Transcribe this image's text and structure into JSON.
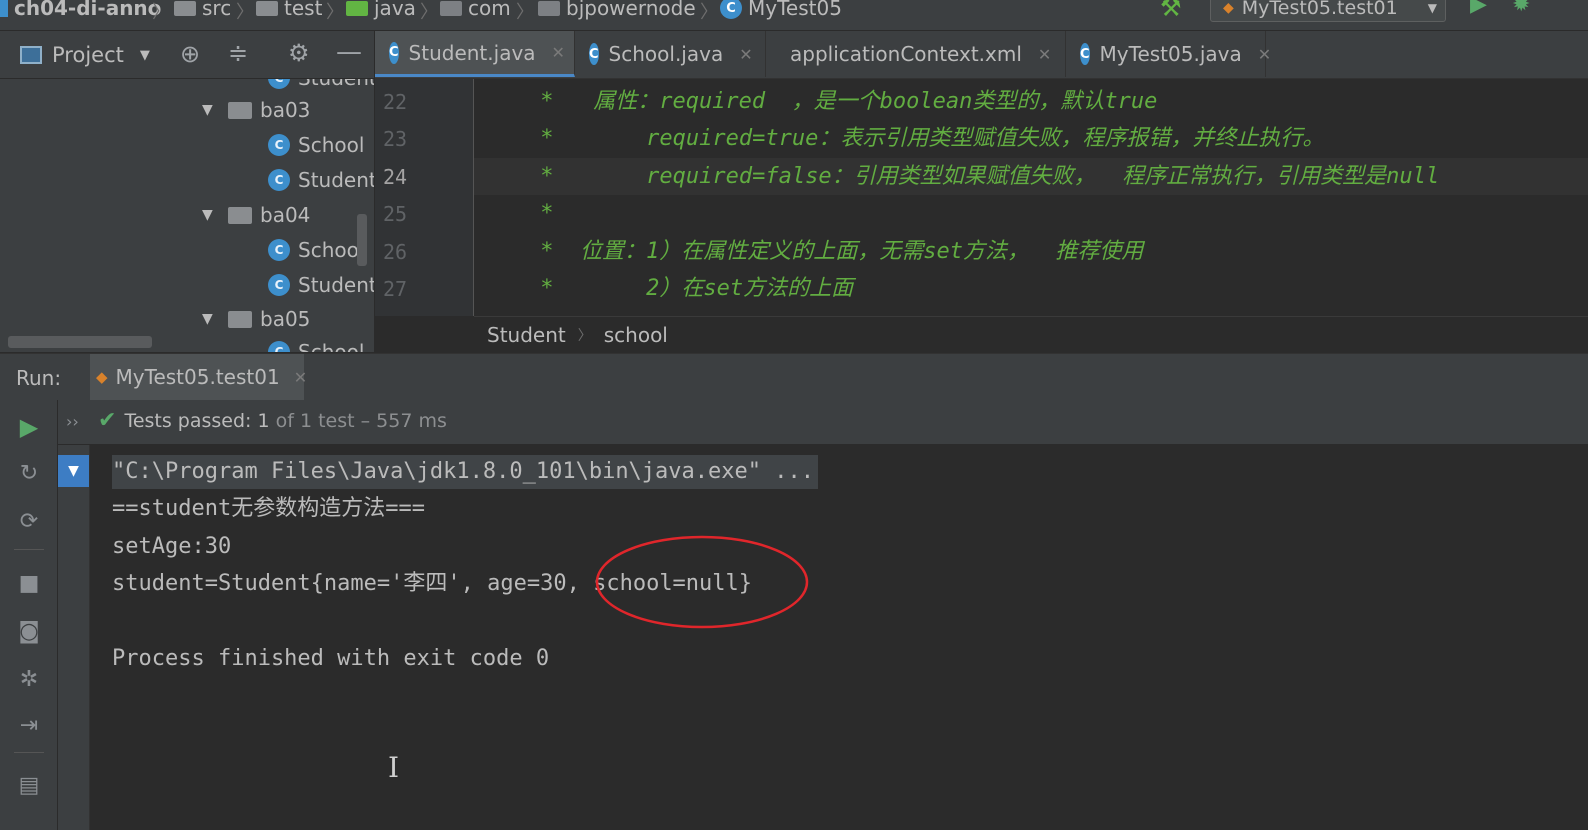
{
  "breadcrumb": {
    "items": [
      "ch04-di-anno",
      "src",
      "test",
      "java",
      "com",
      "bjpowernode",
      "MyTest05"
    ],
    "run_config": "MyTest05.test01"
  },
  "project_panel": {
    "title": "Project"
  },
  "tabs": [
    {
      "label": "Student.java",
      "active": true
    },
    {
      "label": "School.java",
      "active": false
    },
    {
      "label": "applicationContext.xml",
      "active": false
    },
    {
      "label": "MyTest05.java",
      "active": false
    }
  ],
  "tree": {
    "partial_top": "Student",
    "items": [
      {
        "kind": "package",
        "label": "ba03"
      },
      {
        "kind": "class",
        "label": "School"
      },
      {
        "kind": "class",
        "label": "Student"
      },
      {
        "kind": "package",
        "label": "ba04"
      },
      {
        "kind": "class",
        "label": "School"
      },
      {
        "kind": "class",
        "label": "Student"
      },
      {
        "kind": "package",
        "label": "ba05"
      }
    ],
    "partial_bottom": "School"
  },
  "editor": {
    "lines": [
      {
        "num": "22",
        "text": "     *   属性：required  ，是一个boolean类型的，默认true"
      },
      {
        "num": "23",
        "text": "     *       required=true：表示引用类型赋值失败，程序报错，并终止执行。"
      },
      {
        "num": "24",
        "text": "     *       required=false：引用类型如果赋值失败，  程序正常执行，引用类型是null"
      },
      {
        "num": "25",
        "text": "     *"
      },
      {
        "num": "26",
        "text": "     *  位置：1）在属性定义的上面，无需set方法，  推荐使用"
      },
      {
        "num": "27",
        "text": "     *       2）在set方法的上面"
      }
    ],
    "highlighted_line": "24",
    "breadcrumb": [
      "Student",
      "school"
    ]
  },
  "run": {
    "label": "Run:",
    "tab": "MyTest05.test01",
    "status": {
      "prefix": "Tests passed: ",
      "passed": "1",
      "of_text": " of 1 test",
      "duration": " – 557 ms"
    },
    "console": [
      "\"C:\\Program Files\\Java\\jdk1.8.0_101\\bin\\java.exe\" ...",
      "==student无参数构造方法===",
      "setAge:30",
      "student=Student{name='李四', age=30, school=null}",
      "",
      "Process finished with exit code 0"
    ]
  },
  "colors": {
    "accent": "#4a88c7",
    "comment_green": "#62ad41",
    "annotation_circle": "#e0262b",
    "pass_green": "#59a869"
  }
}
